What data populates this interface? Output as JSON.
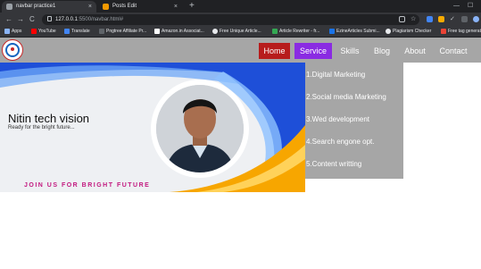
{
  "browser": {
    "tabs": [
      {
        "title": "navbar practice1",
        "active": true,
        "favicon_color": "#9aa0a6"
      },
      {
        "title": "Posts Edit",
        "active": false,
        "favicon_color": "#f29900"
      }
    ],
    "tab_close_glyph": "×",
    "new_tab_glyph": "+",
    "window_controls": [
      "⌄",
      "—",
      "☐"
    ],
    "nav": {
      "back": "←",
      "forward": "→",
      "reload": "C"
    },
    "url_host": "127.0.0.1",
    "url_path": ":5500/navbar.html#",
    "bookmarks": [
      {
        "label": "Apps",
        "icon_color": "#8ab4f8"
      },
      {
        "label": "YouTube",
        "icon_color": "#ff0000"
      },
      {
        "label": "Translate",
        "icon_color": "#4285f4"
      },
      {
        "label": "Pngtree Affiliate Pr...",
        "icon_color": "#5f6368"
      },
      {
        "label": "Amazon.in Associat...",
        "icon_color": "#ffffff"
      },
      {
        "label": "Free Unique Article...",
        "icon_color": "#e8eaed"
      },
      {
        "label": "Article Rewriter - fr...",
        "icon_color": "#34a853"
      },
      {
        "label": "EzineArticles Submi...",
        "icon_color": "#1a73e8"
      },
      {
        "label": "Plagiarism Checker",
        "icon_color": "#e8eaed"
      },
      {
        "label": "Free tag generat",
        "icon_color": "#ea4335"
      }
    ]
  },
  "site": {
    "nav": [
      {
        "label": "Home",
        "color": "#b71c1c"
      },
      {
        "label": "Service",
        "color": "#8a2be2"
      },
      {
        "label": "Skills"
      },
      {
        "label": "Blog"
      },
      {
        "label": "About"
      },
      {
        "label": "Contact"
      }
    ],
    "dropdown": [
      "1.Digital Marketing",
      "2.Social media Marketing",
      "3.Wed development",
      "4.Search engone opt.",
      "5.Content writting"
    ],
    "banner": {
      "title": "Nitin tech vision",
      "subtitle": "Ready for the bright future...",
      "tagline": "JOIN US FOR BRIGHT FUTURE"
    },
    "colors": {
      "navbar": "#a6a6a6",
      "accent_blue": "#1e4fd8",
      "accent_orange": "#f7a600",
      "tagline": "#c2187f"
    }
  }
}
